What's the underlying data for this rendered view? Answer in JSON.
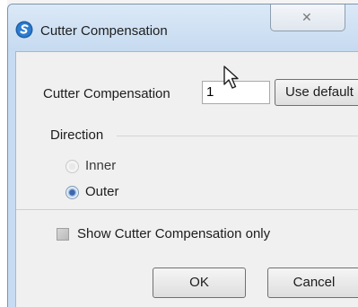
{
  "window": {
    "title": "Cutter Compensation",
    "close_glyph": "✕",
    "icon": "app-logo-icon"
  },
  "form": {
    "cutter_compensation_label": "Cutter Compensation",
    "cutter_compensation_value": "1",
    "use_default_label": "Use default"
  },
  "direction": {
    "group_label": "Direction",
    "options": [
      {
        "label": "Inner",
        "checked": false,
        "enabled": false
      },
      {
        "label": "Outer",
        "checked": true,
        "enabled": true
      }
    ]
  },
  "show_only": {
    "label": "Show Cutter Compensation only",
    "checked": true
  },
  "buttons": {
    "ok_label": "OK",
    "cancel_label": "Cancel"
  },
  "colors": {
    "title_bar": "#c7dcf2",
    "dialog_background": "#f0f0f0",
    "radio_selected": "#3b67b0"
  }
}
